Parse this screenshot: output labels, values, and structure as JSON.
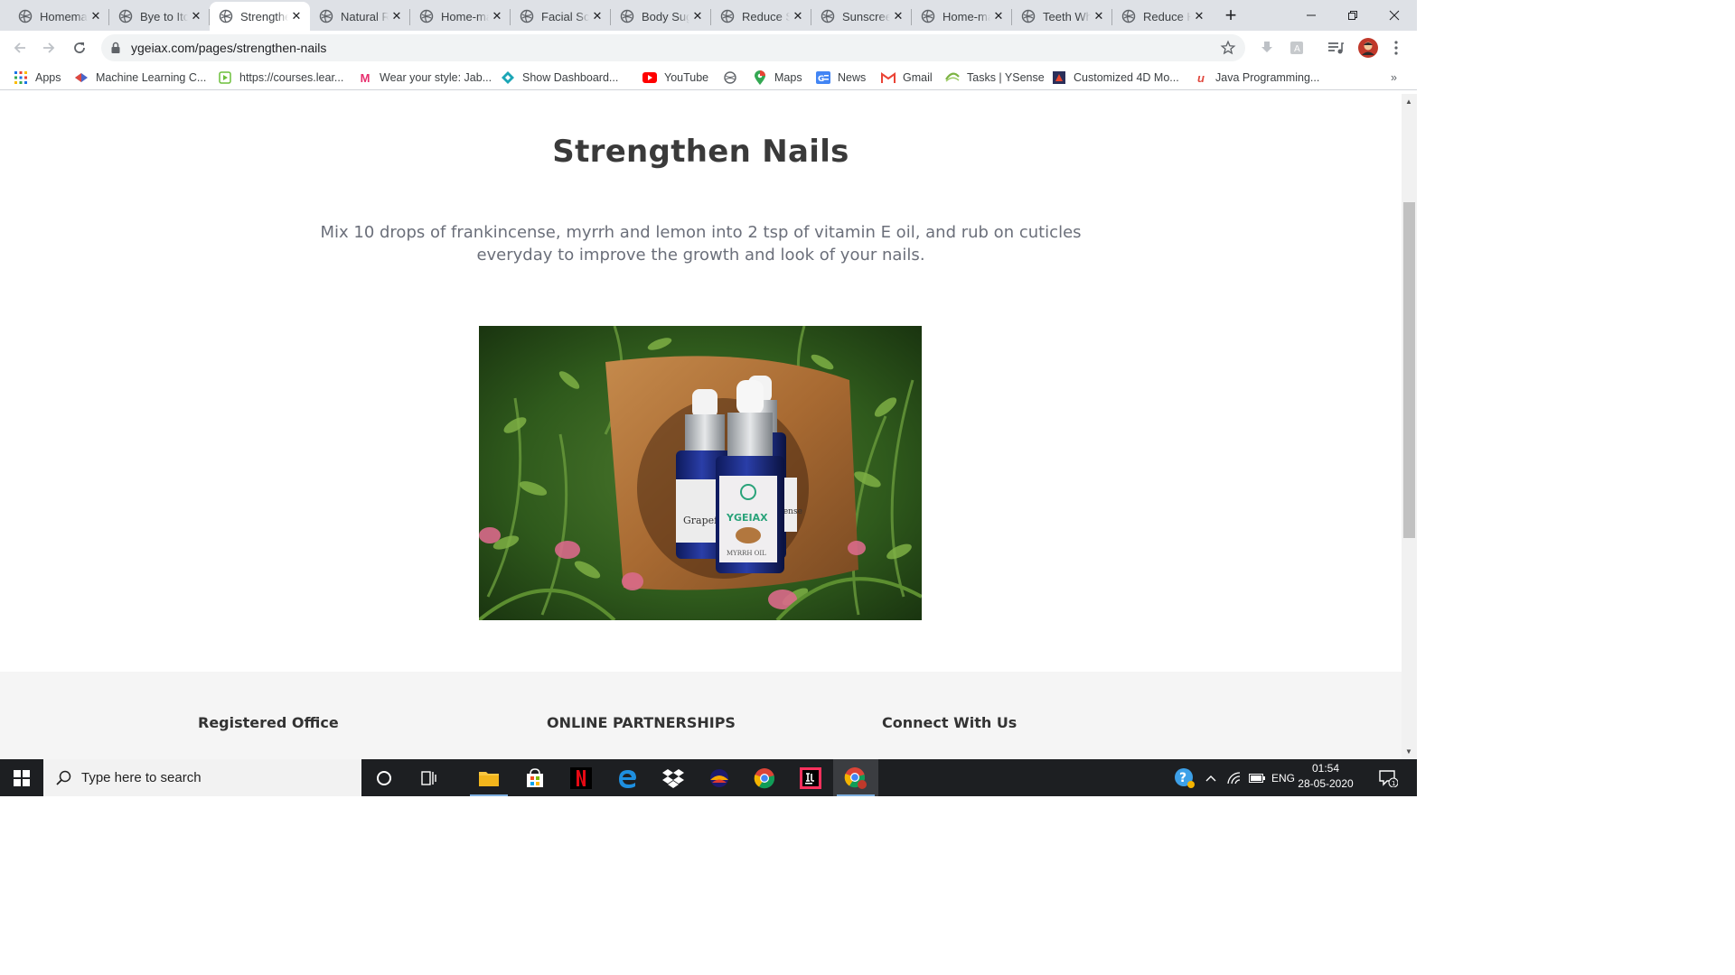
{
  "browser": {
    "tabs": [
      {
        "title": "Homemade"
      },
      {
        "title": "Bye to Itchy"
      },
      {
        "title": "Strengthen Nails",
        "active": true
      },
      {
        "title": "Natural Remedies"
      },
      {
        "title": "Home-made"
      },
      {
        "title": "Facial Scrub"
      },
      {
        "title": "Body Sugar"
      },
      {
        "title": "Reduce Scars"
      },
      {
        "title": "Sunscreen"
      },
      {
        "title": "Home-made"
      },
      {
        "title": "Teeth Whitening"
      },
      {
        "title": "Reduce Hair"
      }
    ],
    "url": "ygeiax.com/pages/strengthen-nails",
    "bookmarks": [
      {
        "label": "Apps",
        "icon": "apps-grid-icon"
      },
      {
        "label": "Machine Learning C...",
        "icon": "ml-icon"
      },
      {
        "label": "https://courses.lear...",
        "icon": "courses-icon"
      },
      {
        "label": "Wear your style: Jab...",
        "icon": "myntra-icon"
      },
      {
        "label": "Show Dashboard...",
        "icon": "dashboard-icon"
      },
      {
        "label": "YouTube",
        "icon": "youtube-icon"
      },
      {
        "label": "",
        "icon": "globe-icon"
      },
      {
        "label": "Maps",
        "icon": "maps-icon"
      },
      {
        "label": "News",
        "icon": "news-icon"
      },
      {
        "label": "Gmail",
        "icon": "gmail-icon"
      },
      {
        "label": "Tasks | YSense",
        "icon": "ysense-icon"
      },
      {
        "label": "Customized 4D Mo...",
        "icon": "4d-icon"
      },
      {
        "label": "Java Programming...",
        "icon": "java-icon"
      }
    ]
  },
  "page": {
    "title": "Strengthen Nails",
    "description": "Mix 10 drops of frankincense, myrrh and lemon into 2 tsp of vitamin E oil, and rub on cuticles everyday to improve the growth and look of your nails.",
    "hero_image": {
      "bottle_labels": [
        "Grapef",
        "YGEIAX",
        "MYRRH OIL",
        "ncense"
      ]
    },
    "footer": {
      "headings": [
        "Registered Office",
        "ONLINE PARTNERSHIPS",
        "Connect With Us"
      ]
    }
  },
  "taskbar": {
    "search_placeholder": "Type here to search",
    "language": "ENG",
    "time": "01:54",
    "date": "28-05-2020",
    "notification_count": "1"
  },
  "colors": {
    "accent": "#1a73e8",
    "title_text": "#3a3a3a",
    "body_text": "#6b6f7a",
    "footer_bg": "#f5f5f5"
  }
}
